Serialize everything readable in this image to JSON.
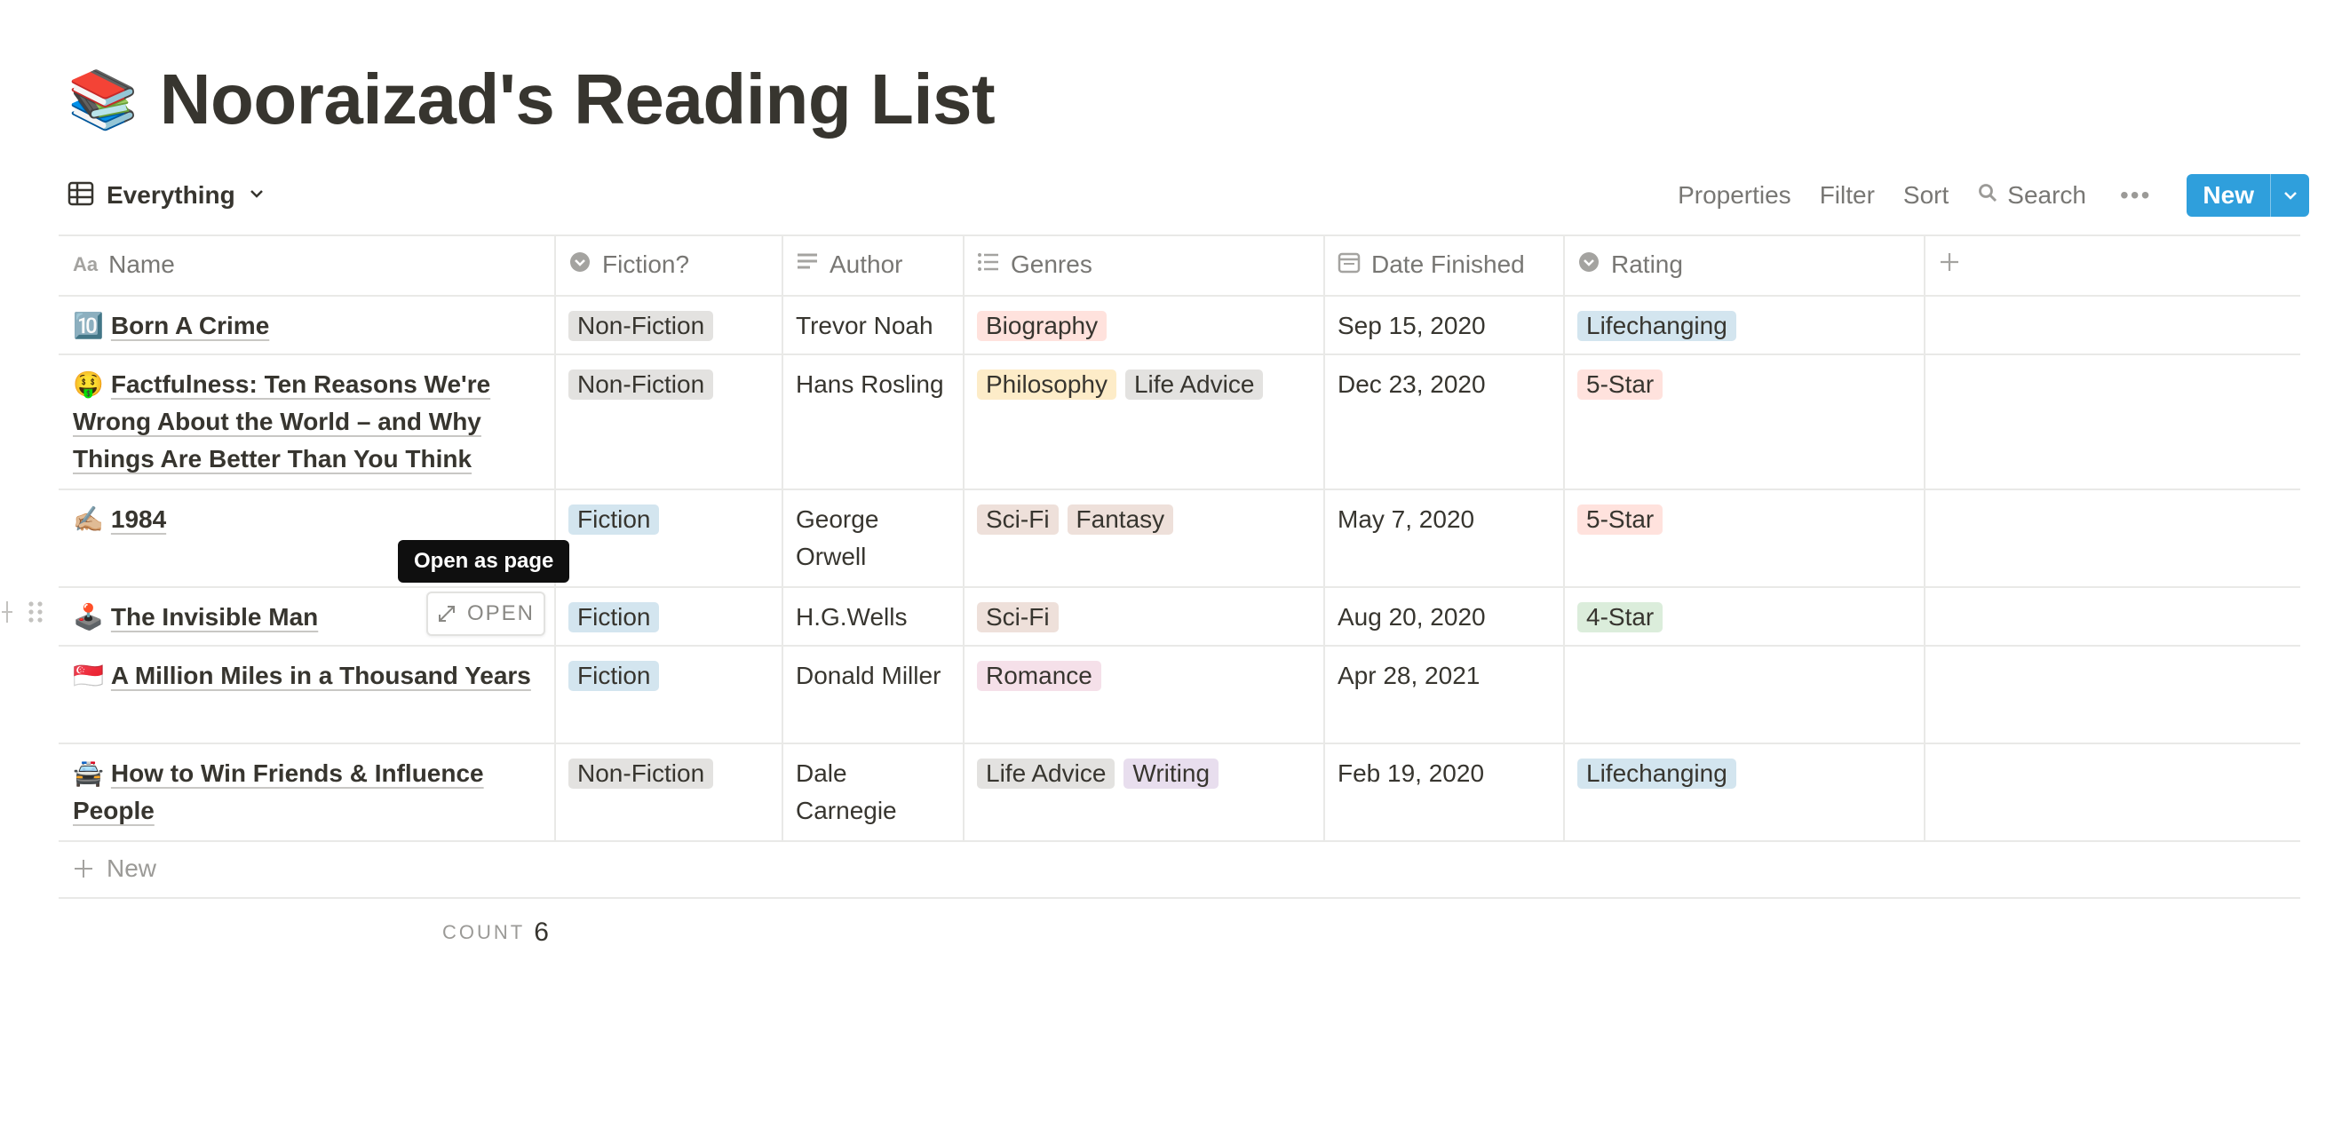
{
  "page": {
    "emoji": "📚",
    "title": "Nooraizad's Reading List"
  },
  "toolbar": {
    "view_label": "Everything",
    "properties": "Properties",
    "filter": "Filter",
    "sort": "Sort",
    "search": "Search",
    "more": "•••",
    "new_label": "New"
  },
  "columns": [
    {
      "label": "Name",
      "icon": "text-icon"
    },
    {
      "label": "Fiction?",
      "icon": "select-icon"
    },
    {
      "label": "Author",
      "icon": "text-lines-icon"
    },
    {
      "label": "Genres",
      "icon": "list-icon"
    },
    {
      "label": "Date Finished",
      "icon": "calendar-icon"
    },
    {
      "label": "Rating",
      "icon": "select-icon"
    }
  ],
  "rows": [
    {
      "emoji": "🔟",
      "name": "Born A Crime",
      "fiction": "Non-Fiction",
      "author": "Trevor Noah",
      "genres": [
        "Biography"
      ],
      "date": "Sep 15, 2020",
      "rating": "Lifechanging"
    },
    {
      "emoji": "🤑",
      "name": "Factfulness: Ten Reasons We're Wrong About the World – and Why Things Are Better Than You Think",
      "fiction": "Non-Fiction",
      "author": "Hans Rosling",
      "genres": [
        "Philosophy",
        "Life Advice"
      ],
      "date": "Dec 23, 2020",
      "rating": "5-Star"
    },
    {
      "emoji": "✍🏼",
      "name": "1984",
      "fiction": "Fiction",
      "author": "George Orwell",
      "genres": [
        "Sci-Fi",
        "Fantasy"
      ],
      "date": "May 7, 2020",
      "rating": "5-Star"
    },
    {
      "emoji": "🕹️",
      "name": "The Invisible Man",
      "fiction": "Fiction",
      "author": "H.G.Wells",
      "genres": [
        "Sci-Fi"
      ],
      "date": "Aug 20, 2020",
      "rating": "4-Star"
    },
    {
      "emoji": "🇸🇬",
      "name": "A Million Miles in a Thousand Years",
      "fiction": "Fiction",
      "author": "Donald Miller",
      "genres": [
        "Romance"
      ],
      "date": "Apr 28, 2021",
      "rating": ""
    },
    {
      "emoji": "🚔",
      "name": "How to Win Friends & Influence People",
      "fiction": "Non-Fiction",
      "author": "Dale Carnegie",
      "genres": [
        "Life Advice",
        "Writing"
      ],
      "date": "Feb 19, 2020",
      "rating": "Lifechanging"
    }
  ],
  "tag_colors": {
    "Non-Fiction": "#e3e2e0",
    "Fiction": "#d3e5ef",
    "Biography": "#ffe2dd",
    "Philosophy": "#fdecc8",
    "Life Advice": "#e3e2e0",
    "Sci-Fi": "#eee0da",
    "Fantasy": "#eee0da",
    "Romance": "#f5e0e9",
    "Writing": "#e8deee",
    "Lifechanging": "#d3e5ef",
    "5-Star": "#ffe2dd",
    "4-Star": "#dbeddb"
  },
  "tooltip": "Open as page",
  "open_button": "OPEN",
  "new_row_label": "New",
  "footer": {
    "count_label": "COUNT",
    "count_value": "6"
  }
}
